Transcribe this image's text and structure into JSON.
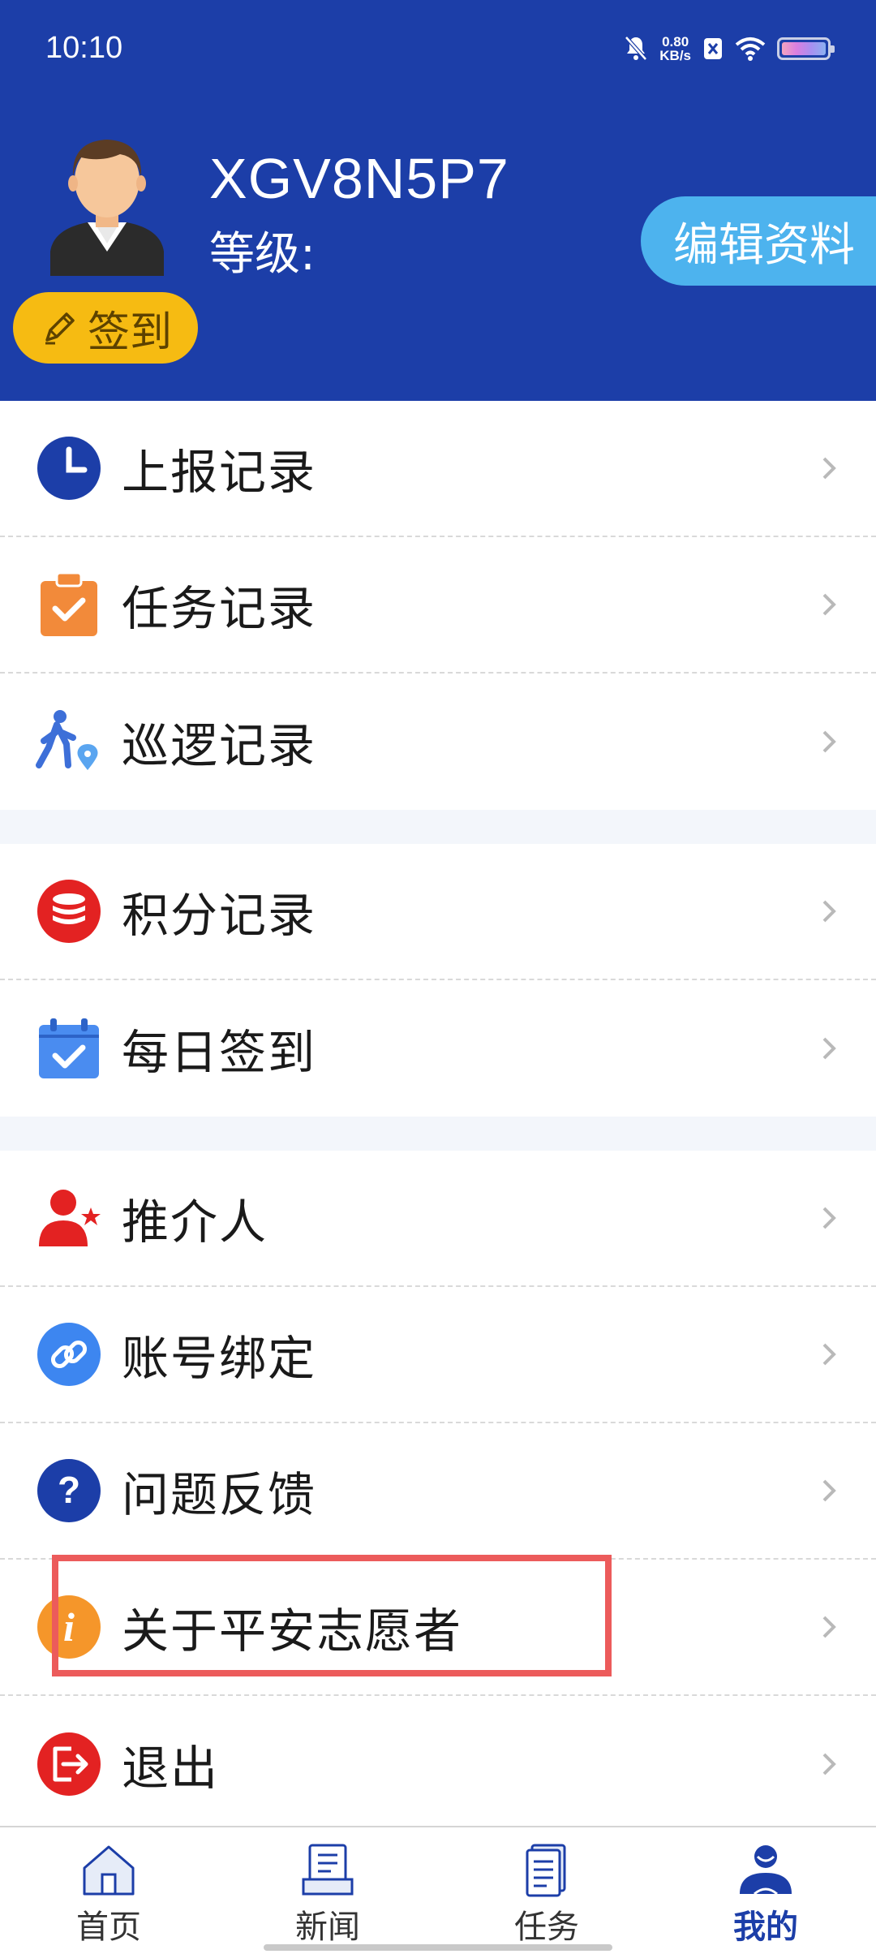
{
  "status_bar": {
    "time": "10:10",
    "speed_value": "0.80",
    "speed_unit": "KB/s"
  },
  "profile": {
    "username": "XGV8N5P7",
    "level_label": "等级:",
    "edit_label": "编辑资料",
    "checkin_label": "签到"
  },
  "menu": {
    "items": [
      {
        "label": "上报记录",
        "icon": "clock-icon"
      },
      {
        "label": "任务记录",
        "icon": "clipboard-check-icon"
      },
      {
        "label": "巡逻记录",
        "icon": "patrol-walker-icon"
      },
      {
        "label": "积分记录",
        "icon": "coin-stack-icon"
      },
      {
        "label": "每日签到",
        "icon": "calendar-check-icon"
      },
      {
        "label": "推介人",
        "icon": "user-star-icon"
      },
      {
        "label": "账号绑定",
        "icon": "link-icon"
      },
      {
        "label": "问题反馈",
        "icon": "question-icon"
      },
      {
        "label": "关于平安志愿者",
        "icon": "info-icon"
      },
      {
        "label": "退出",
        "icon": "logout-icon"
      }
    ]
  },
  "bottom_nav": {
    "items": [
      {
        "label": "首页",
        "icon": "home-icon"
      },
      {
        "label": "新闻",
        "icon": "news-icon"
      },
      {
        "label": "任务",
        "icon": "task-icon"
      },
      {
        "label": "我的",
        "icon": "profile-icon"
      }
    ],
    "active_index": 3
  },
  "colors": {
    "header": "#1c3ea8",
    "edit_button": "#4db3ee",
    "checkin_button": "#f6bb12",
    "highlight": "#ec5b5b"
  }
}
